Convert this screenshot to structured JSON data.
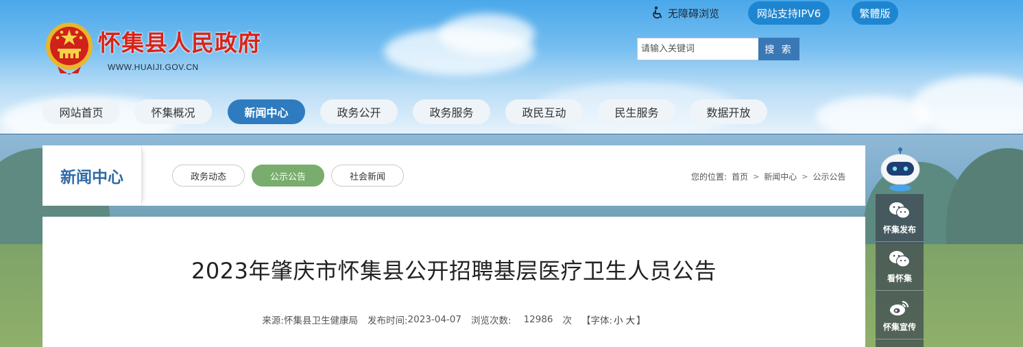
{
  "site": {
    "title": "怀集县人民政府",
    "url": "WWW.HUAIJI.GOV.CN"
  },
  "top_links": {
    "accessibility": "无障碍浏览",
    "ipv6": "网站支持IPV6",
    "traditional": "繁體版"
  },
  "search": {
    "placeholder": "请输入关键词",
    "button": "搜 索"
  },
  "nav": {
    "items": [
      {
        "label": "网站首页"
      },
      {
        "label": "怀集概况"
      },
      {
        "label": "新闻中心"
      },
      {
        "label": "政务公开"
      },
      {
        "label": "政务服务"
      },
      {
        "label": "政民互动"
      },
      {
        "label": "民生服务"
      },
      {
        "label": "数据开放"
      }
    ],
    "active": "新闻中心"
  },
  "section": {
    "title": "新闻中心",
    "tabs": [
      {
        "label": "政务动态"
      },
      {
        "label": "公示公告"
      },
      {
        "label": "社会新闻"
      }
    ],
    "active_tab": "公示公告"
  },
  "breadcrumb": {
    "prefix": "您的位置:",
    "items": [
      "首页",
      "新闻中心",
      "公示公告"
    ],
    "separator": ">"
  },
  "article": {
    "title": "2023年肇庆市怀集县公开招聘基层医疗卫生人员公告",
    "source_label": "来源:",
    "source": "怀集县卫生健康局",
    "date_label": "发布时间:",
    "date": "2023-04-07",
    "views_label": "浏览次数:",
    "views": "12986",
    "views_unit": "次",
    "font_label": "【字体:",
    "font_small": "小",
    "font_large": "大",
    "font_close": "】"
  },
  "side_panel": {
    "items": [
      {
        "label": "怀集发布",
        "icon": "wechat-icon"
      },
      {
        "label": "看怀集",
        "icon": "wechat-icon"
      },
      {
        "label": "怀集宣传",
        "icon": "weibo-icon"
      }
    ]
  },
  "colors": {
    "brand_red": "#d8231a",
    "nav_active": "#2e7bbf",
    "tab_active": "#79ad6e",
    "section_title": "#2e6aa6"
  }
}
